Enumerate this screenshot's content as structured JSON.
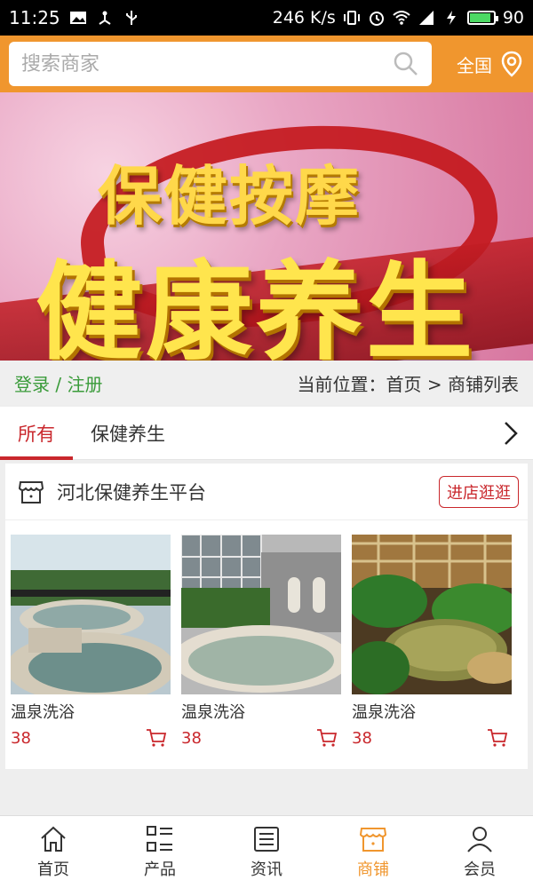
{
  "status": {
    "time": "11:25",
    "speed": "246 K/s",
    "battery": "90",
    "battery_level": 0.9
  },
  "search": {
    "placeholder": "搜索商家"
  },
  "region": {
    "label": "全国"
  },
  "banner": {
    "line1": "保健按摩",
    "line2": "健康养生"
  },
  "breadcrumb": {
    "login": "登录 / 注册",
    "path": "当前位置：首页 > 商铺列表"
  },
  "tabs": [
    {
      "label": "所有"
    },
    {
      "label": "保健养生"
    }
  ],
  "shop": {
    "name": "河北保健养生平台",
    "visit_label": "进店逛逛",
    "products": [
      {
        "name": "温泉洗浴",
        "price": "38"
      },
      {
        "name": "温泉洗浴",
        "price": "38"
      },
      {
        "name": "温泉洗浴",
        "price": "38"
      }
    ]
  },
  "nav": [
    {
      "label": "首页",
      "icon": "home-icon"
    },
    {
      "label": "产品",
      "icon": "grid-list-icon"
    },
    {
      "label": "资讯",
      "icon": "news-icon"
    },
    {
      "label": "商铺",
      "icon": "store-icon"
    },
    {
      "label": "会员",
      "icon": "user-icon"
    }
  ],
  "colors": {
    "accent": "#f0962e",
    "red": "#c9272c",
    "green": "#3a9b3a"
  }
}
